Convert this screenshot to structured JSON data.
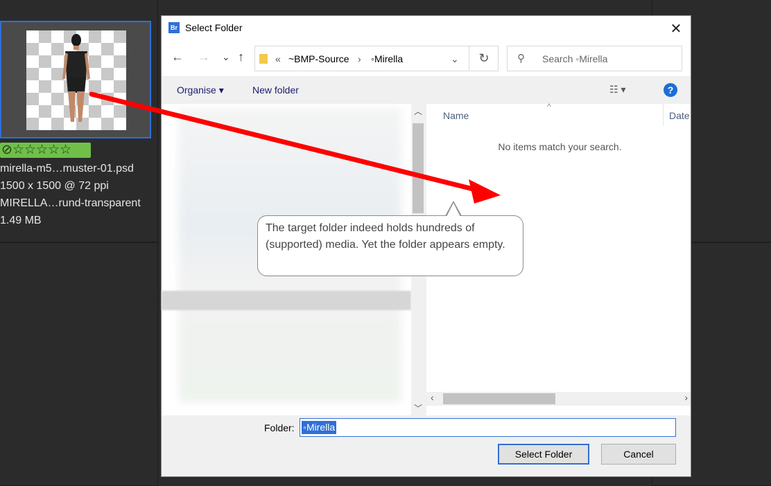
{
  "bridge": {
    "thumbnail_alt": "thumbnail",
    "filename": "mirella-m5…muster-01.psd",
    "dimensions": "1500 x 1500 @ 72 ppi",
    "keywords": "MIRELLA…rund-transparent",
    "filesize": "1.49 MB",
    "rating_reject_icon": "reject-icon",
    "rating_stars": "☆☆☆☆☆"
  },
  "dialog": {
    "title": "Select Folder",
    "app_icon_text": "Br",
    "close_label": "✕",
    "nav": {
      "back": "←",
      "forward": "→",
      "recent": "⌄",
      "up": "↑"
    },
    "address": {
      "chevrons": "«",
      "crumb1": "~BMP-Source",
      "sep": "›",
      "crumb2": "◦Mirella",
      "dropdown": "⌄",
      "refresh": "↻"
    },
    "search_placeholder": "Search ◦Mirella",
    "toolbar": {
      "organise": "Organise ▾",
      "new_folder": "New folder",
      "view": "☷ ▾",
      "help": "?"
    },
    "columns": {
      "name": "Name",
      "date": "Date",
      "sort": "^"
    },
    "empty_message": "No items match your search.",
    "folder_label": "Folder:",
    "folder_value": "◦Mirella",
    "select_button": "Select Folder",
    "cancel_button": "Cancel"
  },
  "annotation": {
    "callout_text": "The target folder indeed holds hundreds of (supported) media. Yet the folder appears empty.",
    "arrow_color": "#ff0000"
  }
}
